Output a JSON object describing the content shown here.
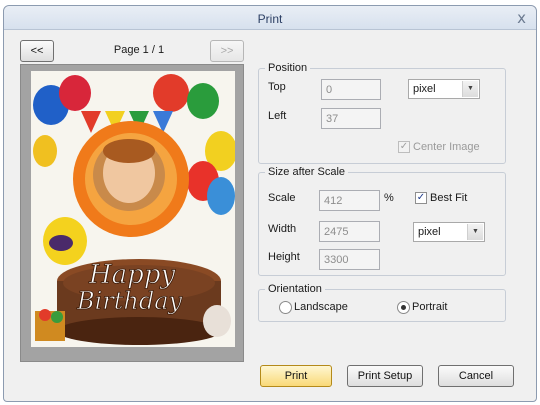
{
  "window": {
    "title": "Print",
    "close_glyph": "x"
  },
  "pager": {
    "prev_label": "<<",
    "next_label": ">>",
    "page_label": "Page 1 / 1"
  },
  "preview": {
    "image_text_line1": "Happy",
    "image_text_line2": "Birthday",
    "cake_color": "#6b3a1e",
    "flower_color": "#f07a1a"
  },
  "position": {
    "legend": "Position",
    "top_label": "Top",
    "top_value": "0",
    "left_label": "Left",
    "left_value": "37",
    "unit_value": "pixel",
    "center_image_label": "Center Image",
    "center_image_checked": true
  },
  "size": {
    "legend": "Size after Scale",
    "scale_label": "Scale",
    "scale_value": "412",
    "percent_label": "%",
    "best_fit_label": "Best Fit",
    "best_fit_checked": true,
    "width_label": "Width",
    "width_value": "2475",
    "height_label": "Height",
    "height_value": "3300",
    "unit_value": "pixel"
  },
  "orientation": {
    "legend": "Orientation",
    "landscape_label": "Landscape",
    "portrait_label": "Portrait",
    "selected": "Portrait"
  },
  "buttons": {
    "print": "Print",
    "print_setup": "Print Setup",
    "cancel": "Cancel"
  }
}
